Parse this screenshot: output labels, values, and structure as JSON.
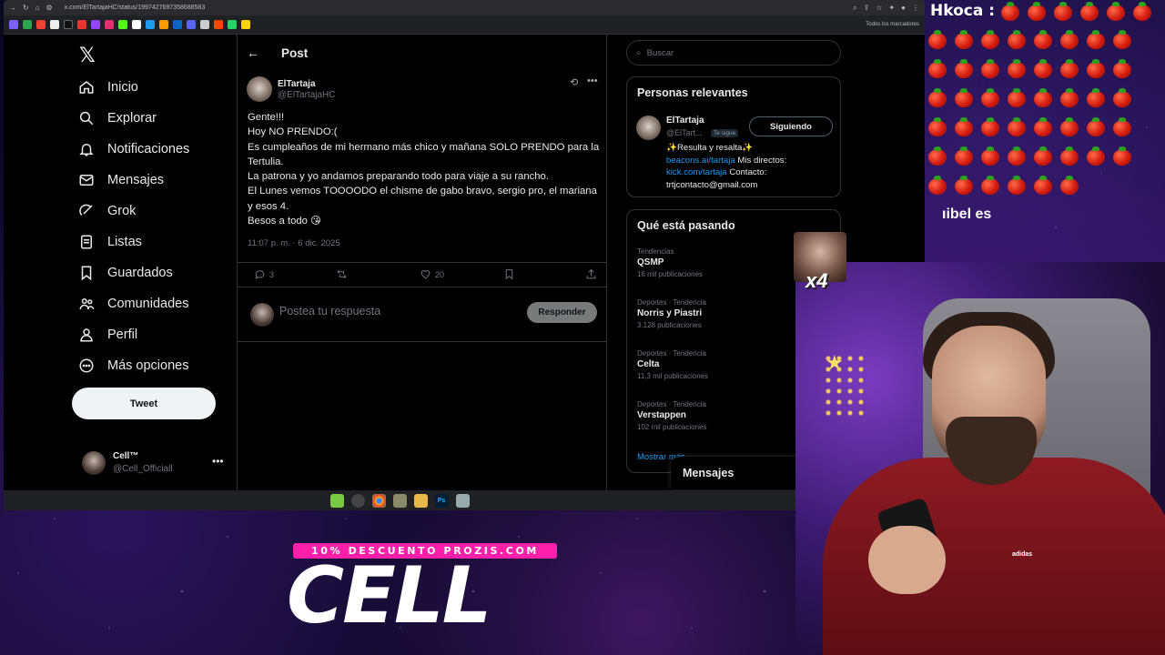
{
  "browser": {
    "url": "x.com/ElTartajaHC/status/1997427697358688583",
    "bookmarks_all": "Todos los marcadores"
  },
  "nav": {
    "items": [
      {
        "label": "Inicio",
        "icon": "home-icon"
      },
      {
        "label": "Explorar",
        "icon": "search-icon"
      },
      {
        "label": "Notificaciones",
        "icon": "bell-icon"
      },
      {
        "label": "Mensajes",
        "icon": "mail-icon"
      },
      {
        "label": "Grok",
        "icon": "grok-icon"
      },
      {
        "label": "Listas",
        "icon": "list-icon"
      },
      {
        "label": "Guardados",
        "icon": "bookmark-icon"
      },
      {
        "label": "Comunidades",
        "icon": "communities-icon"
      },
      {
        "label": "Perfil",
        "icon": "profile-icon"
      },
      {
        "label": "Más opciones",
        "icon": "more-circle-icon"
      }
    ],
    "tweet_button": "Tweet",
    "account": {
      "name": "Cell™",
      "handle": "@Cell_Officiall"
    }
  },
  "post": {
    "header": "Post",
    "author_name": "ElTartaja",
    "author_handle": "@ElTartajaHC",
    "text": "Gente!!!\nHoy NO PRENDO:(\nEs cumpleaños de mi hermano más chico y mañana SOLO PRENDO para la Tertulia.\nLa patrona y yo andamos preparando todo para viaje a su rancho.\nEl Lunes vemos TOOOODO el chisme de gabo bravo, sergio pro, el mariana y esos 4.\nBesos a todo 😘",
    "timestamp": "11:07 p. m. · 6 dic. 2025",
    "replies": "3",
    "likes": "20",
    "reply_placeholder": "Postea tu respuesta",
    "reply_button": "Responder"
  },
  "sidebar": {
    "search_placeholder": "Buscar",
    "relevant": {
      "title": "Personas relevantes",
      "name": "ElTartaja",
      "handle": "@ElTart...",
      "follows_you": "Te sigue",
      "follow_button": "Siguiendo",
      "bio_line1": "✨Resulta y resalta✨",
      "bio_link1": "beacons.ai/tartaja",
      "bio_text2": " Mis directos:",
      "bio_link2": "kick.com/tartaja",
      "bio_text3": " Contacto:",
      "bio_email": "trtjcontacto@gmail.com"
    },
    "trending": {
      "title": "Qué está pasando",
      "items": [
        {
          "category": "Tendencias",
          "name": "QSMP",
          "count": "16 mil publicaciones"
        },
        {
          "category": "Deportes · Tendencia",
          "name": "Norris y Piastri",
          "count": "3.128 publicaciones"
        },
        {
          "category": "Deportes · Tendencia",
          "name": "Celta",
          "count": "11,3 mil publicaciones"
        },
        {
          "category": "Deportes · Tendencia",
          "name": "Verstappen",
          "count": "102 mil publicaciones"
        }
      ],
      "show_more": "Mostrar más"
    },
    "messages_drawer": "Mensajes"
  },
  "overlay": {
    "chat_user": "Hkoca :",
    "chat_text": "ıibel es",
    "sub_multiplier": "x4",
    "promo": "10% DESCUENTO PROZIS.COM",
    "brand": "CELL",
    "shirt_logo": "adidas"
  }
}
